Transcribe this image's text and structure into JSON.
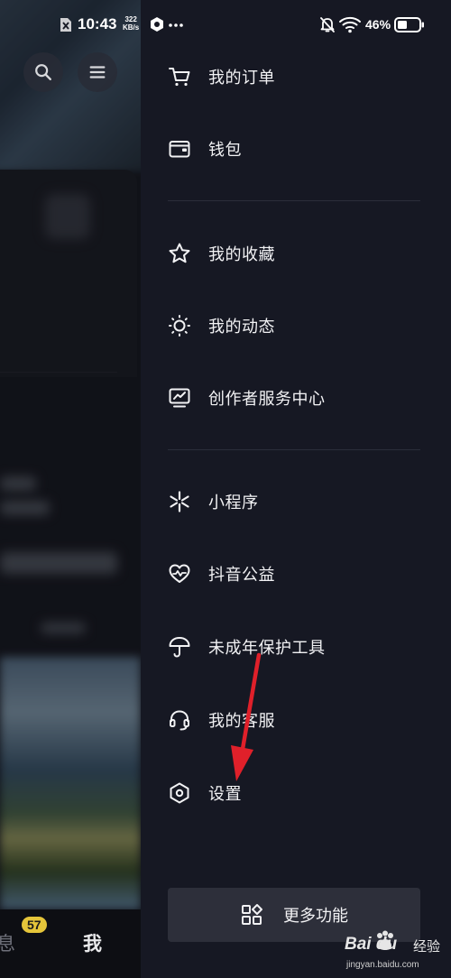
{
  "status_bar": {
    "time": "10:43",
    "net_speed_value": "322",
    "net_speed_unit": "KB/s",
    "battery": "46%"
  },
  "background": {
    "tab_message_label": "息",
    "tab_badge_count": "57",
    "tab_me_label": "我"
  },
  "drawer": {
    "items": [
      {
        "label": "我的订单",
        "icon": "cart-icon"
      },
      {
        "label": "钱包",
        "icon": "wallet-icon"
      },
      {
        "label": "我的收藏",
        "icon": "star-icon"
      },
      {
        "label": "我的动态",
        "icon": "activity-icon"
      },
      {
        "label": "创作者服务中心",
        "icon": "creator-monitor-icon"
      },
      {
        "label": "小程序",
        "icon": "mini-program-icon"
      },
      {
        "label": "抖音公益",
        "icon": "charity-heart-icon"
      },
      {
        "label": "未成年保护工具",
        "icon": "umbrella-icon"
      },
      {
        "label": "我的客服",
        "icon": "headset-icon"
      },
      {
        "label": "设置",
        "icon": "settings-hexagon-icon"
      }
    ],
    "more_button_label": "更多功能"
  },
  "watermark": {
    "brand": "Bai du",
    "brand_suffix": "经验",
    "url": "jingyan.baidu.com"
  },
  "colors": {
    "drawer_bg": "#161823",
    "more_button_bg": "#2d2f3a",
    "annotation_arrow": "#e0202a",
    "badge": "#e5c53a"
  }
}
